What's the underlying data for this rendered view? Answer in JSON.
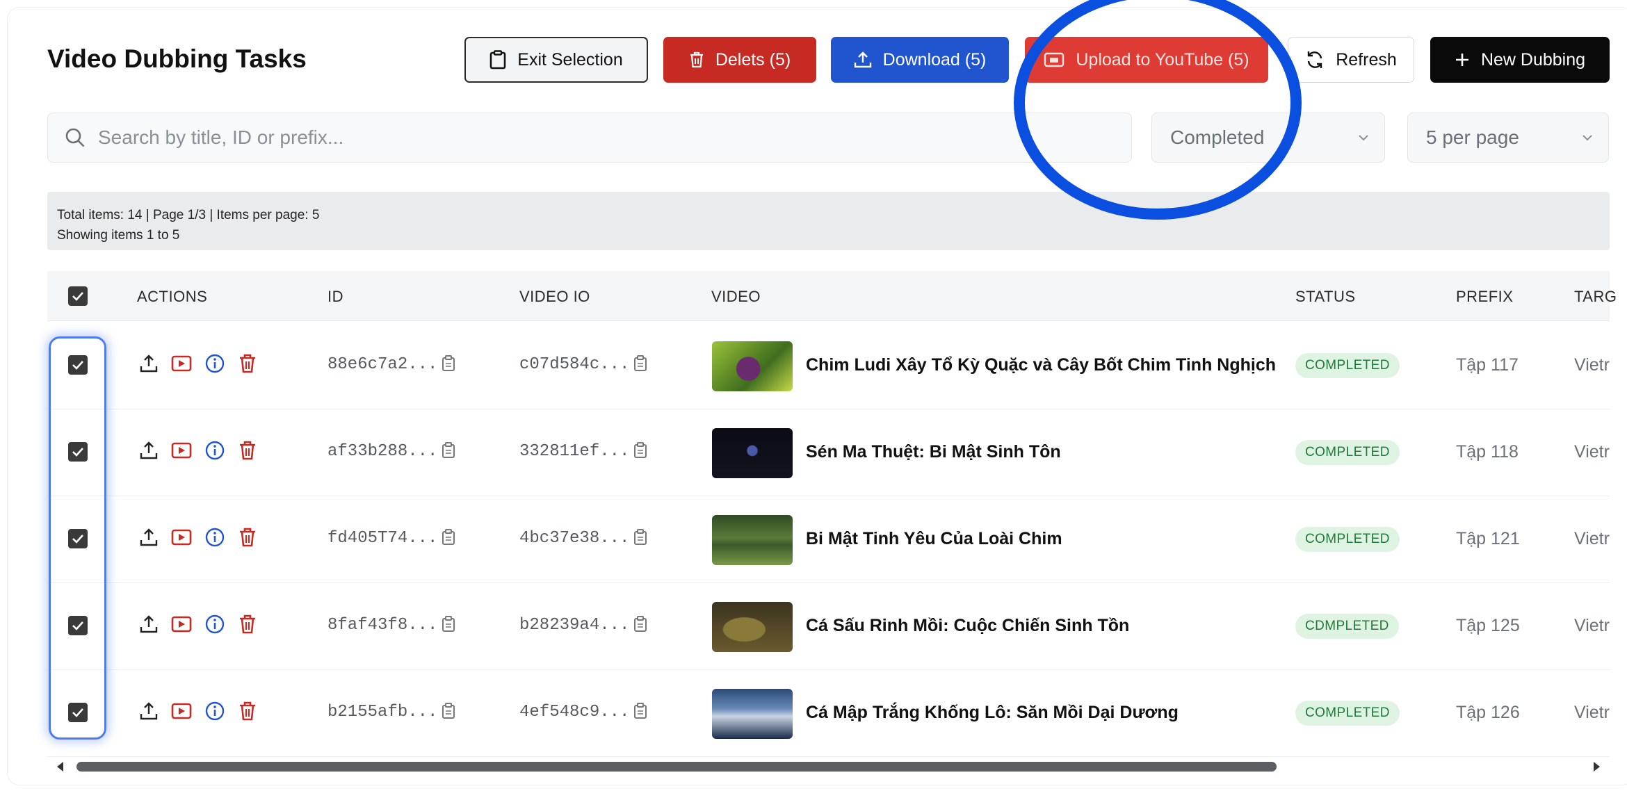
{
  "header": {
    "title": "Video Dubbing Tasks",
    "exit_label": "Exit Selection",
    "delete_label": "Delets (5)",
    "download_label": "Download (5)",
    "upload_label": "Upload to YouTube (5)",
    "refresh_label": "Refresh",
    "new_label": "New Dubbing"
  },
  "search": {
    "placeholder": "Search by title, ID or prefix...",
    "value": ""
  },
  "filters": {
    "status_selected": "Completed",
    "per_page_selected": "5 per page"
  },
  "summary": {
    "line1": "Total items: 14 | Page 1/3 | Items per page: 5",
    "line2": "Showing items 1 to 5"
  },
  "table": {
    "headers": {
      "actions": "ACTIONS",
      "id": "ID",
      "video_id": "VIDEO IO",
      "video": "VIDEO",
      "status": "STATUS",
      "prefix": "PREFIX",
      "target": "TARG"
    },
    "rows": [
      {
        "id": "88e6c7a2...",
        "video_id": "c07d584c...",
        "title": "Chim Ludi Xây Tổ Kỳ Quặc và Cây Bốt Chim Tinh Nghịch",
        "status": "COMPLETED",
        "prefix": "Tập 117",
        "target": "Vietr"
      },
      {
        "id": "af33b288...",
        "video_id": "332811ef...",
        "title": "Sén Ma Thuệt: Bi Mật Sinh Tôn",
        "status": "COMPLETED",
        "prefix": "Tập 118",
        "target": "Vietr"
      },
      {
        "id": "fd405T74...",
        "video_id": "4bc37e38...",
        "title": "Bi Mật Tinh Yêu Của Loài Chim",
        "status": "COMPLETED",
        "prefix": "Tập 121",
        "target": "Vietr"
      },
      {
        "id": "8faf43f8...",
        "video_id": "b28239a4...",
        "title": "Cá Sấu Rinh Mồi: Cuộc Chiến Sinh Tồn",
        "status": "CDMPLETED",
        "prefix": "Tập 125",
        "target": "Vietr"
      },
      {
        "id": "b2155afb...",
        "video_id": "4ef548c9...",
        "title": "Cá Mập Trắng Khống Lô: Săn Mồi Dại Dương",
        "status": "COMPLETED",
        "prefix": "Tập 126",
        "target": "Vietr"
      }
    ]
  },
  "colors": {
    "delete": "#c62a23",
    "download": "#2155cf",
    "upload": "#de3b34",
    "new": "#0a0a0a",
    "badge_bg": "#dff3e3",
    "badge_text": "#1f7a3a",
    "annotation": "#0b4fe0"
  },
  "icons": {
    "exit": "clipboard-icon",
    "delete": "trash-icon",
    "download": "upload-tray-icon",
    "upload": "youtube-icon",
    "refresh": "refresh-icon",
    "new": "plus-icon",
    "search": "search-icon",
    "row_actions": [
      "upload-icon",
      "youtube-icon",
      "info-icon",
      "trash-icon"
    ],
    "copy": "copy-icon"
  }
}
